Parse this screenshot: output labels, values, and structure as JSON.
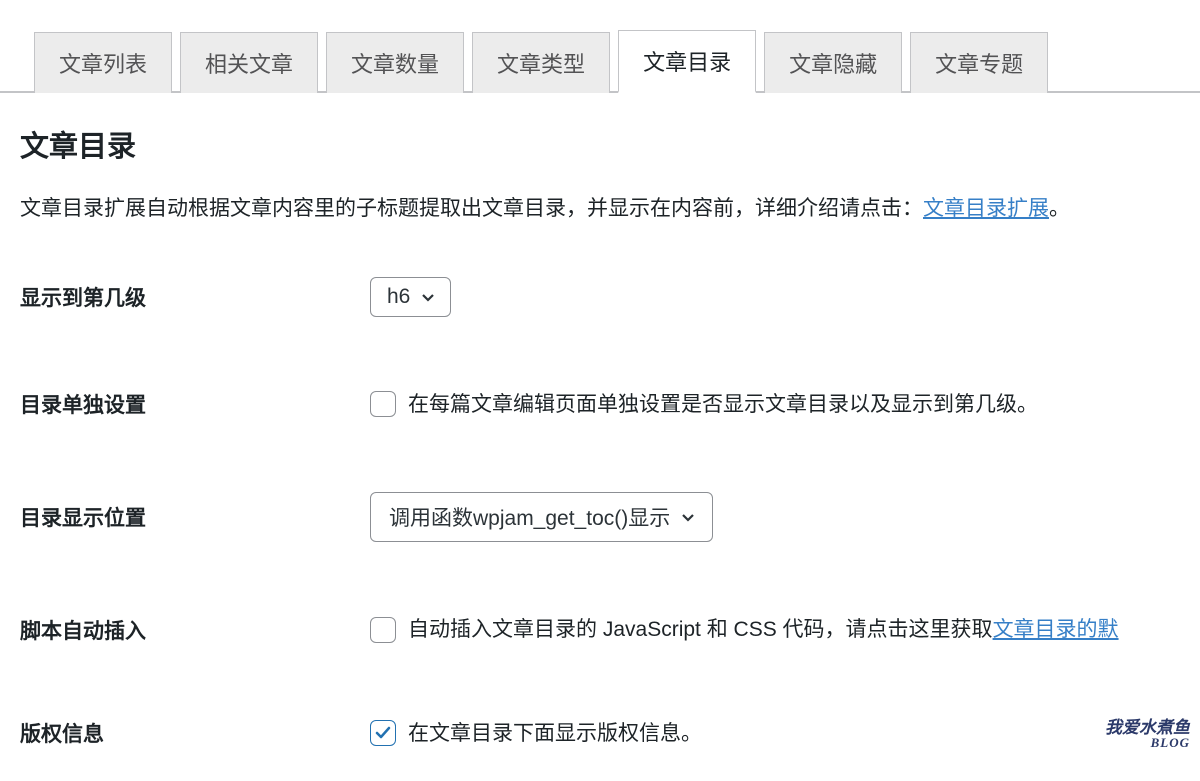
{
  "tabs": [
    {
      "label": "文章列表",
      "active": false
    },
    {
      "label": "相关文章",
      "active": false
    },
    {
      "label": "文章数量",
      "active": false
    },
    {
      "label": "文章类型",
      "active": false
    },
    {
      "label": "文章目录",
      "active": true
    },
    {
      "label": "文章隐藏",
      "active": false
    },
    {
      "label": "文章专题",
      "active": false
    }
  ],
  "section": {
    "title": "文章目录",
    "description_pre": "文章目录扩展自动根据文章内容里的子标题提取出文章目录，并显示在内容前，详细介绍请点击：",
    "description_link": "文章目录扩展",
    "description_post": "。"
  },
  "fields": {
    "level": {
      "label": "显示到第几级",
      "value": "h6"
    },
    "individual": {
      "label": "目录单独设置",
      "checked": false,
      "text": "在每篇文章编辑页面单独设置是否显示文章目录以及显示到第几级。"
    },
    "position": {
      "label": "目录显示位置",
      "value": "调用函数wpjam_get_toc()显示"
    },
    "script": {
      "label": "脚本自动插入",
      "checked": false,
      "text_pre": "自动插入文章目录的 JavaScript 和 CSS 代码，请点击这里获取",
      "link_text": "文章目录的默"
    },
    "copyright": {
      "label": "版权信息",
      "checked": true,
      "text": "在文章目录下面显示版权信息。"
    }
  },
  "watermark": {
    "line1": "我爱水煮鱼",
    "line2": "BLOG"
  }
}
